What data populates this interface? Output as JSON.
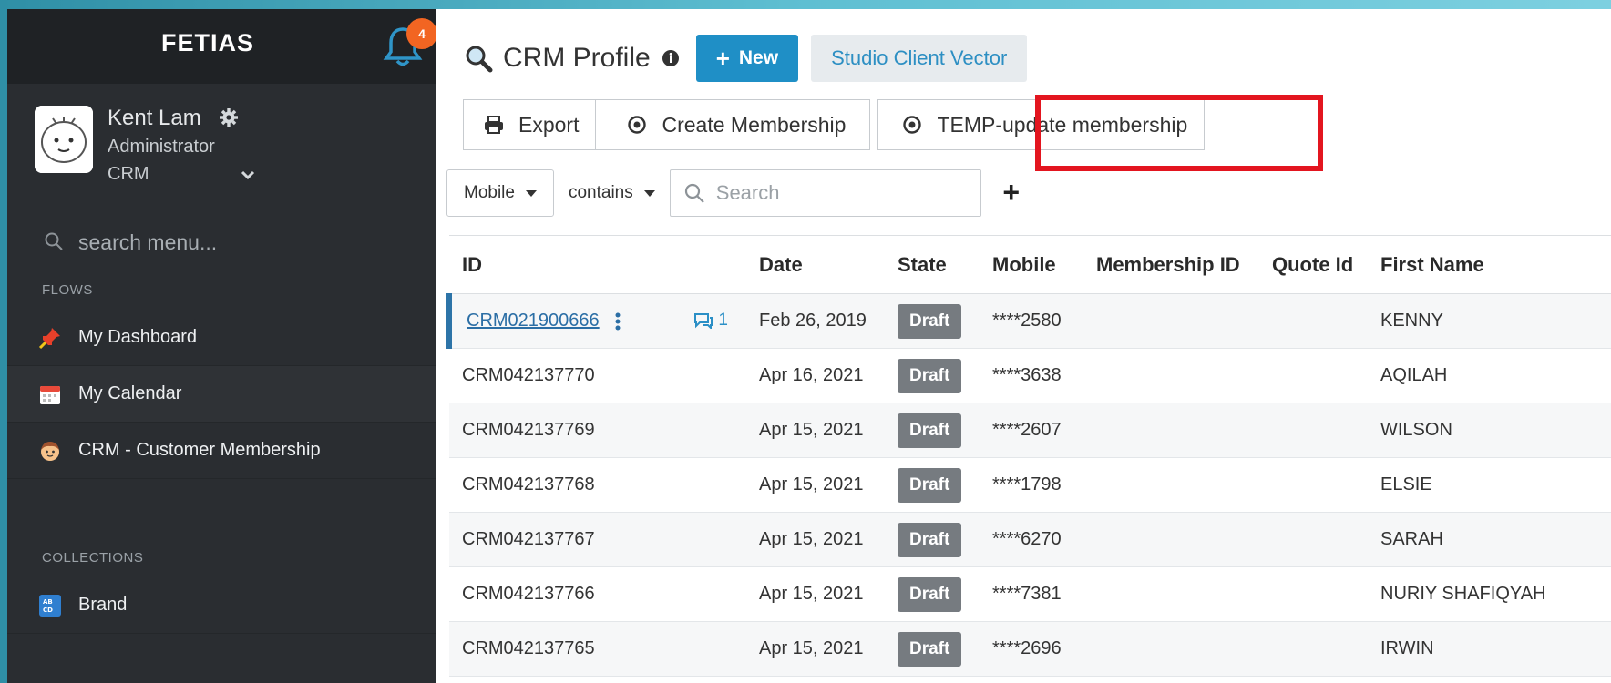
{
  "sidebar": {
    "brand": "FETIAS",
    "notification_count": "4",
    "user": {
      "name": "Kent Lam",
      "role": "Administrator",
      "app": "CRM"
    },
    "search_placeholder": "search menu...",
    "flows_label": "FLOWS",
    "flows": [
      {
        "label": "My Dashboard",
        "icon": "pin-icon"
      },
      {
        "label": "My Calendar",
        "icon": "calendar-icon"
      },
      {
        "label": "CRM - Customer Membership",
        "icon": "face-icon"
      }
    ],
    "collections_label": "COLLECTIONS",
    "collections": [
      {
        "label": "Brand",
        "icon": "abcd-icon"
      }
    ]
  },
  "header": {
    "title": "CRM Profile",
    "new_label": "New",
    "client_label": "Studio Client Vector"
  },
  "actions": {
    "export_label": "Export",
    "create_membership_label": "Create Membership",
    "temp_update_label": "TEMP-update membership"
  },
  "filter": {
    "field": "Mobile",
    "operator": "contains",
    "search_placeholder": "Search"
  },
  "table": {
    "columns": [
      "ID",
      "Date",
      "State",
      "Mobile",
      "Membership ID",
      "Quote Id",
      "First Name"
    ],
    "rows": [
      {
        "id": "CRM021900666",
        "date": "Feb 26, 2019",
        "state": "Draft",
        "mobile": "****2580",
        "membership_id": "",
        "quote_id": "",
        "first_name": "KENNY",
        "comments": "1"
      },
      {
        "id": "CRM042137770",
        "date": "Apr 16, 2021",
        "state": "Draft",
        "mobile": "****3638",
        "membership_id": "",
        "quote_id": "",
        "first_name": "AQILAH"
      },
      {
        "id": "CRM042137769",
        "date": "Apr 15, 2021",
        "state": "Draft",
        "mobile": "****2607",
        "membership_id": "",
        "quote_id": "",
        "first_name": "WILSON"
      },
      {
        "id": "CRM042137768",
        "date": "Apr 15, 2021",
        "state": "Draft",
        "mobile": "****1798",
        "membership_id": "",
        "quote_id": "",
        "first_name": "ELSIE"
      },
      {
        "id": "CRM042137767",
        "date": "Apr 15, 2021",
        "state": "Draft",
        "mobile": "****6270",
        "membership_id": "",
        "quote_id": "",
        "first_name": "SARAH"
      },
      {
        "id": "CRM042137766",
        "date": "Apr 15, 2021",
        "state": "Draft",
        "mobile": "****7381",
        "membership_id": "",
        "quote_id": "",
        "first_name": "NURIY SHAFIQYAH"
      },
      {
        "id": "CRM042137765",
        "date": "Apr 15, 2021",
        "state": "Draft",
        "mobile": "****2696",
        "membership_id": "",
        "quote_id": "",
        "first_name": "IRWIN"
      }
    ]
  },
  "colors": {
    "accent": "#1f8fc6",
    "highlight": "#e3151f",
    "sidebar_bg": "#2a2d31",
    "badge_bg": "#767b80",
    "notification": "#f26522"
  }
}
